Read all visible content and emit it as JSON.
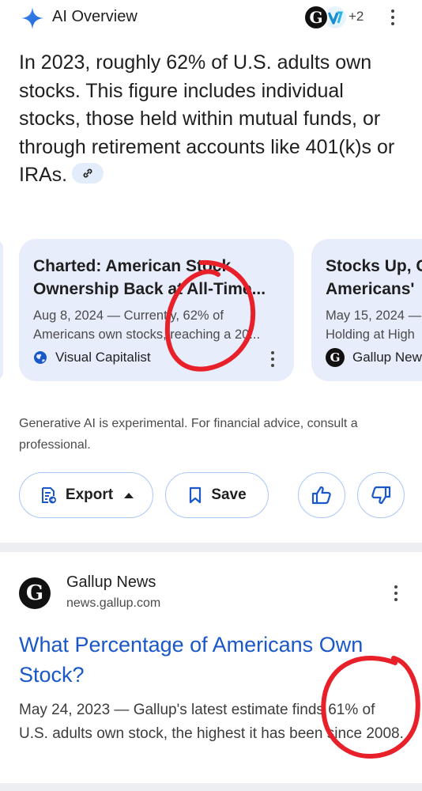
{
  "header": {
    "title": "AI Overview",
    "icon": "sparkle-icon",
    "avatars_extra": "+2"
  },
  "overview": {
    "text": "In 2023, roughly 62% of U.S. adults own stocks. This figure includes individual stocks, those held within mutual funds, or through retirement accounts like 401(k)s or IRAs."
  },
  "cards": [
    {
      "title_line1": "Charted: American Stock",
      "title_line2": "Ownership Back at All-Time...",
      "snippet_line1": "Aug 8, 2024 — Currently, 62% of",
      "snippet_line2": "Americans own stocks, reaching a 20...",
      "source": "Visual Capitalist",
      "source_icon": "globe-icon"
    },
    {
      "title_line1": "Stocks Up, C",
      "title_line2": "Americans'",
      "snippet_line1": "May 15, 2024 —",
      "snippet_line2": "Holding at High",
      "source": "Gallup News",
      "source_icon": "G"
    }
  ],
  "disclaimer": "Generative AI is experimental. For financial advice, consult a professional.",
  "actions": {
    "export_label": "Export",
    "save_label": "Save"
  },
  "result": {
    "favicon": "G",
    "site_name": "Gallup News",
    "url": "news.gallup.com",
    "title": "What Percentage of Americans Own Stock?",
    "snippet": "May 24, 2023 — Gallup's latest estimate finds 61% of U.S. adults own stock, the highest it has been since 2008."
  },
  "colors": {
    "accent_blue": "#1a57c9",
    "card_bg": "#e8edfb",
    "button_border": "#a8c7fa",
    "annotation_red": "#e8202a"
  }
}
